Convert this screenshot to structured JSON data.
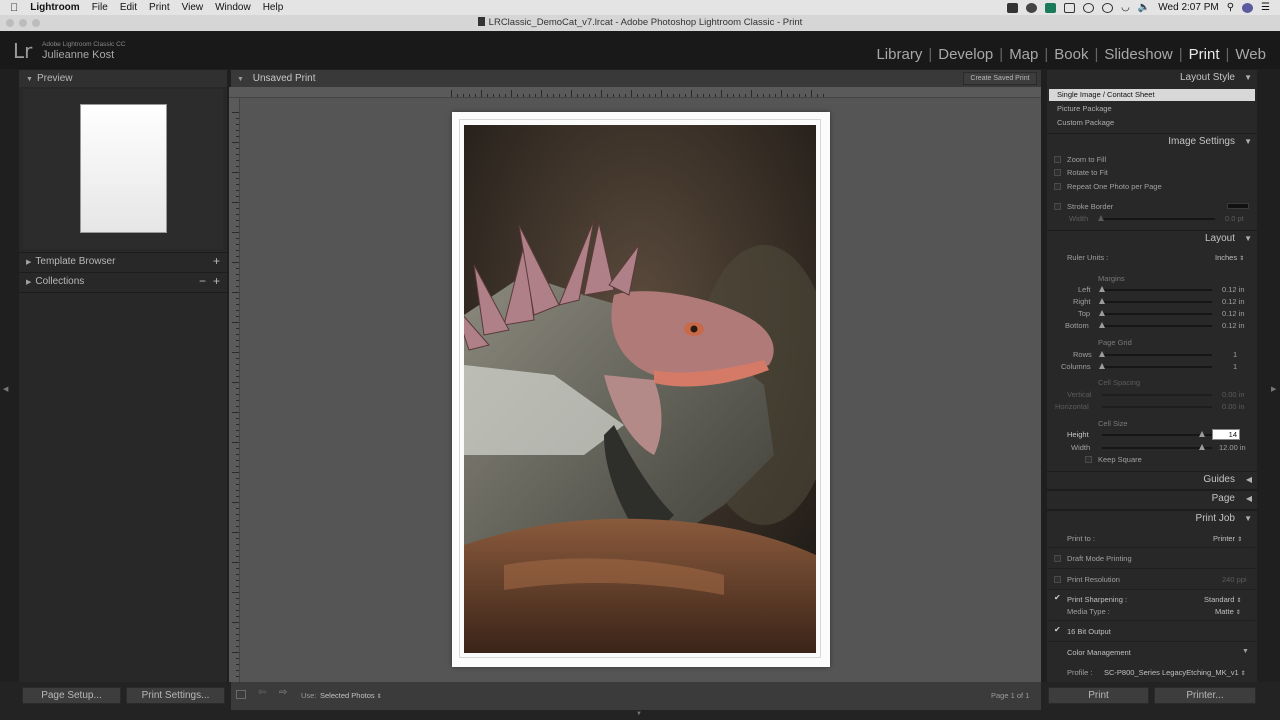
{
  "menubar": {
    "app_name": "Lightroom",
    "menus": [
      "File",
      "Edit",
      "Print",
      "View",
      "Window",
      "Help"
    ],
    "clock": "Wed 2:07 PM"
  },
  "window": {
    "title": "LRClassic_DemoCat_v7.lrcat - Adobe Photoshop Lightroom Classic - Print"
  },
  "identity": {
    "logo": "Lr",
    "product": "Adobe Lightroom Classic CC",
    "user": "Julieanne Kost"
  },
  "modules": [
    "Library",
    "Develop",
    "Map",
    "Book",
    "Slideshow",
    "Print",
    "Web"
  ],
  "active_module": "Print",
  "left_panel": {
    "preview_label": "Preview",
    "template_browser_label": "Template Browser",
    "collections_label": "Collections",
    "plus_glyph": "+",
    "minus_glyph": "−",
    "plus_glyph_2": "+"
  },
  "center": {
    "title": "Unsaved Print",
    "create_saved_print": "Create Saved Print",
    "use_label": "Use:",
    "use_value": "Selected Photos",
    "page_indicator": "Page 1 of 1"
  },
  "layout_style": {
    "header": "Layout Style",
    "options": [
      "Single Image / Contact Sheet",
      "Picture Package",
      "Custom Package"
    ],
    "selected_index": 0
  },
  "image_settings": {
    "header": "Image Settings",
    "zoom_to_fill": "Zoom to Fill",
    "rotate_to_fit": "Rotate to Fit",
    "repeat_one_photo": "Repeat One Photo per Page",
    "stroke_border": "Stroke Border",
    "width_label": "Width",
    "width_value": "0.0 pt"
  },
  "layout": {
    "header": "Layout",
    "ruler_units_label": "Ruler Units :",
    "ruler_units_value": "Inches",
    "margins_label": "Margins",
    "margins": [
      {
        "label": "Left",
        "value": "0.12 in"
      },
      {
        "label": "Right",
        "value": "0.12 in"
      },
      {
        "label": "Top",
        "value": "0.12 in"
      },
      {
        "label": "Bottom",
        "value": "0.12 in"
      }
    ],
    "page_grid_label": "Page Grid",
    "rows_label": "Rows",
    "rows_value": "1",
    "columns_label": "Columns",
    "columns_value": "1",
    "cell_spacing_label": "Cell Spacing",
    "vertical_label": "Vertical",
    "vertical_value": "0.00 in",
    "horizontal_label": "Horizontal",
    "horizontal_value": "0.00 in",
    "cell_size_label": "Cell Size",
    "height_label": "Height",
    "height_input": "14",
    "width_label": "Width",
    "width_value": "12.00 in",
    "keep_square": "Keep Square"
  },
  "collapsed_panels": {
    "guides": "Guides",
    "page": "Page"
  },
  "print_job": {
    "header": "Print Job",
    "print_to_label": "Print to :",
    "print_to_value": "Printer",
    "draft_mode": "Draft Mode Printing",
    "print_resolution": "Print Resolution",
    "print_resolution_value": "240 ppi",
    "print_sharpening": "Print Sharpening :",
    "print_sharpening_value": "Standard",
    "media_type_label": "Media Type :",
    "media_type_value": "Matte",
    "bit_output": "16 Bit Output",
    "color_management": "Color Management",
    "profile_label": "Profile :",
    "profile_value": "SC-P800_Series LegacyEtching_MK_v1"
  },
  "buttons": {
    "page_setup": "Page Setup...",
    "print_settings": "Print Settings...",
    "print": "Print",
    "printer": "Printer..."
  },
  "glyphs": {
    "check": "✔",
    "updown": "⇕",
    "collapse": "▼",
    "expand": "◀",
    "right_tri": "▶"
  },
  "colors": {
    "active_module": "#e8e8e8",
    "panel_bg": "#282828",
    "workarea_bg": "#555555"
  }
}
